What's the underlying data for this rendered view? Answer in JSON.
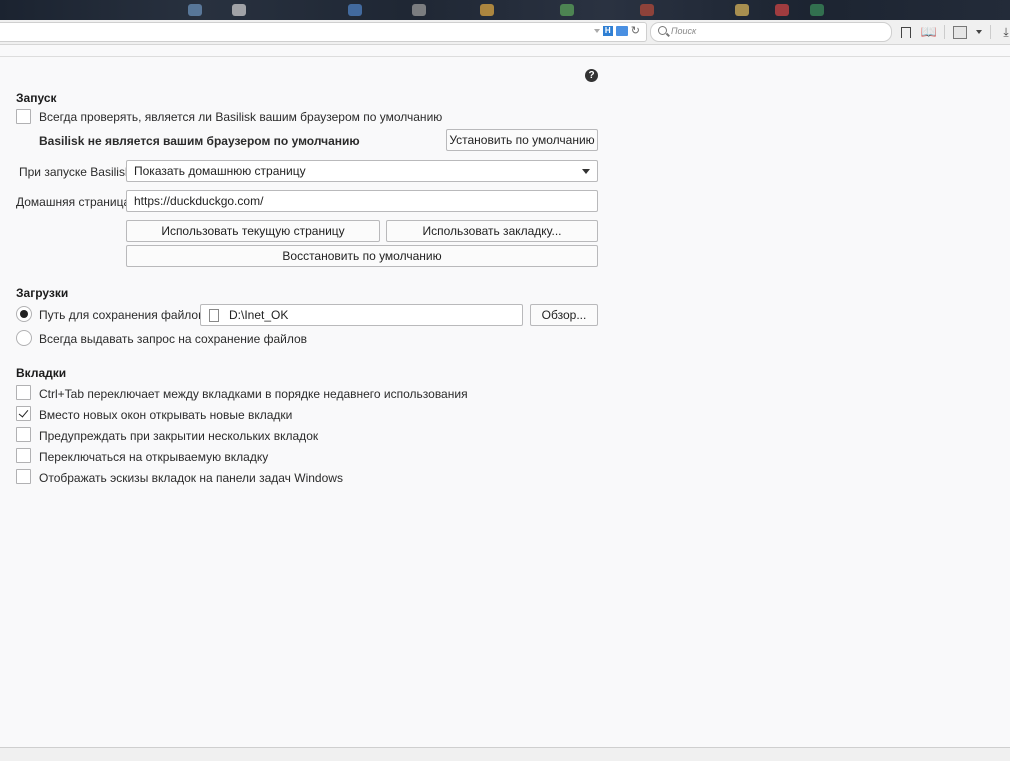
{
  "search": {
    "placeholder": "Поиск"
  },
  "url_badge": "H",
  "help_label": "?",
  "startup": {
    "title": "Запуск",
    "check_default_label": "Всегда проверять, является ли Basilisk вашим браузером по умолчанию",
    "check_default_checked": false,
    "not_default_text": "Basilisk не является вашим браузером по умолчанию",
    "set_default_button": "Установить по умолчанию",
    "on_start_label": "При запуске Basilisk:",
    "on_start_value": "Показать домашнюю страницу",
    "homepage_label": "Домашняя страница:",
    "homepage_value": "https://duckduckgo.com/",
    "use_current_button": "Использовать текущую страницу",
    "use_bookmark_button": "Использовать закладку...",
    "restore_default_button": "Восстановить по умолчанию"
  },
  "downloads": {
    "title": "Загрузки",
    "save_path_label": "Путь для сохранения файлов",
    "save_path_selected": true,
    "save_path_value": "D:\\Inet_OK",
    "browse_button": "Обзор...",
    "always_ask_label": "Всегда выдавать запрос на сохранение файлов",
    "always_ask_selected": false
  },
  "tabs": {
    "title": "Вкладки",
    "items": [
      {
        "label": "Ctrl+Tab переключает между вкладками в порядке недавнего использования",
        "checked": false
      },
      {
        "label": "Вместо новых окон открывать новые вкладки",
        "checked": true
      },
      {
        "label": "Предупреждать при закрытии нескольких вкладок",
        "checked": false
      },
      {
        "label": "Переключаться на открываемую вкладку",
        "checked": false
      },
      {
        "label": "Отображать эскизы вкладок на панели задач Windows",
        "checked": false
      }
    ]
  }
}
